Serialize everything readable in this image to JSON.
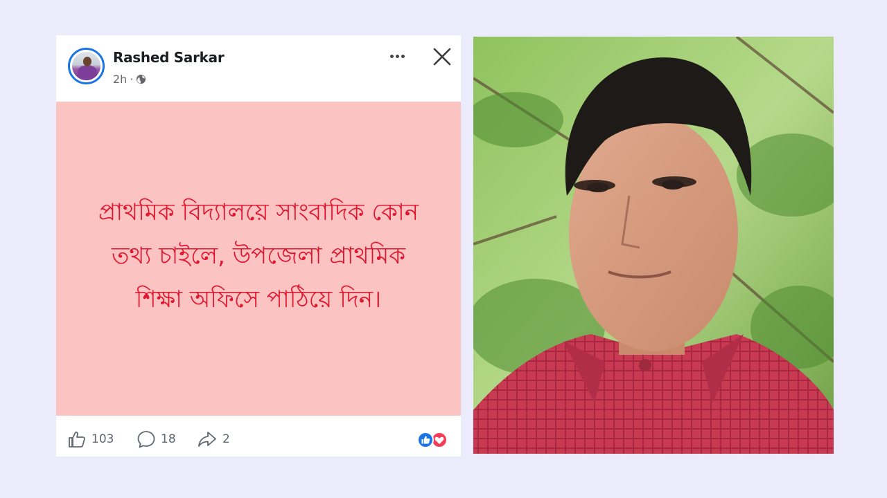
{
  "post": {
    "author": "Rashed Sarkar",
    "time": "2h",
    "separator": "·",
    "text": "প্রাথমিক বিদ্যালয়ে সাংবাদিক কোন তথ্য চাইলে, উপজেলা প্রাথমিক শিক্ষা অফিসে পাঠিয়ে দিন।",
    "background_color": "#fbc3c1",
    "text_color": "#e0162f"
  },
  "stats": {
    "likes": "103",
    "comments": "18",
    "shares": "2"
  },
  "icons": {
    "like": "thumbs-up-icon",
    "comment": "comment-bubble-icon",
    "share": "share-arrow-icon",
    "privacy": "globe-icon",
    "more": "more-options-icon",
    "close": "close-icon",
    "reactions": [
      "like-reaction-icon",
      "love-reaction-icon"
    ]
  },
  "colors": {
    "page_background": "#ecebfb",
    "accent": "#1b74e4",
    "love": "#f33e58"
  }
}
